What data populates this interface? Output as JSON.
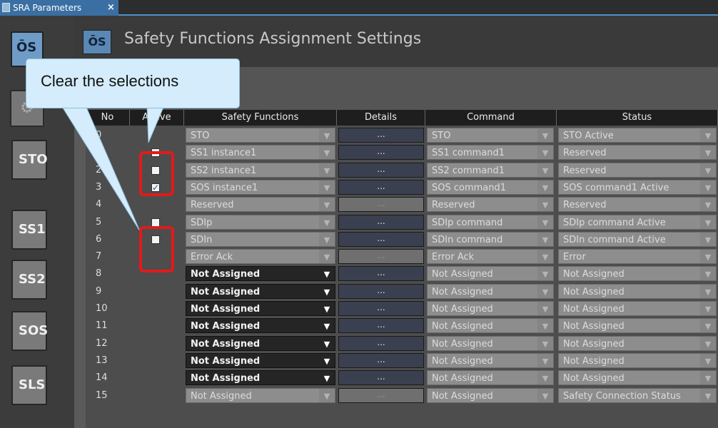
{
  "tab": {
    "title": "SRA Parameters",
    "close": "×"
  },
  "header": {
    "title": "Safety Functions Assignment Settings",
    "icon_text": "ŌS"
  },
  "nav": {
    "top_icon_text": "ŌS",
    "buttons": [
      "STO",
      "SS1",
      "SS2",
      "SOS",
      "SLS"
    ]
  },
  "callout": {
    "text": "Clear the selections"
  },
  "table": {
    "columns": [
      "No",
      "Active",
      "Safety Functions",
      "Details",
      "Command",
      "Status"
    ],
    "details_label": "...",
    "rows": [
      {
        "no": "0",
        "active": "none",
        "function": "STO",
        "command": "STO",
        "status": "STO Active",
        "dim": true
      },
      {
        "no": "1",
        "active": "unchecked",
        "function": "SS1 instance1",
        "command": "SS1 command1",
        "status": "Reserved",
        "dim": true
      },
      {
        "no": "2",
        "active": "unchecked",
        "function": "SS2 instance1",
        "command": "SS2 command1",
        "status": "Reserved",
        "dim": true
      },
      {
        "no": "3",
        "active": "checked",
        "function": "SOS instance1",
        "command": "SOS command1",
        "status": "SOS command1 Active",
        "dim": true
      },
      {
        "no": "4",
        "active": "none",
        "function": "Reserved",
        "command": "Reserved",
        "status": "Reserved",
        "dim": true
      },
      {
        "no": "5",
        "active": "unchecked",
        "function": "SDIp",
        "command": "SDIp command",
        "status": "SDIp command Active",
        "dim": true
      },
      {
        "no": "6",
        "active": "unchecked",
        "function": "SDIn",
        "command": "SDIn command",
        "status": "SDIn command Active",
        "dim": true
      },
      {
        "no": "7",
        "active": "none",
        "function": "Error Ack",
        "command": "Error Ack",
        "status": "Error",
        "dim": true
      },
      {
        "no": "8",
        "active": "none",
        "function": "Not Assigned",
        "command": "Not Assigned",
        "status": "Not Assigned",
        "dim": false
      },
      {
        "no": "9",
        "active": "none",
        "function": "Not Assigned",
        "command": "Not Assigned",
        "status": "Not Assigned",
        "dim": false
      },
      {
        "no": "10",
        "active": "none",
        "function": "Not Assigned",
        "command": "Not Assigned",
        "status": "Not Assigned",
        "dim": false
      },
      {
        "no": "11",
        "active": "none",
        "function": "Not Assigned",
        "command": "Not Assigned",
        "status": "Not Assigned",
        "dim": false
      },
      {
        "no": "12",
        "active": "none",
        "function": "Not Assigned",
        "command": "Not Assigned",
        "status": "Not Assigned",
        "dim": false
      },
      {
        "no": "13",
        "active": "none",
        "function": "Not Assigned",
        "command": "Not Assigned",
        "status": "Not Assigned",
        "dim": false
      },
      {
        "no": "14",
        "active": "none",
        "function": "Not Assigned",
        "command": "Not Assigned",
        "status": "Not Assigned",
        "dim": false
      },
      {
        "no": "15",
        "active": "none",
        "function": "Not Assigned",
        "command": "Not Assigned",
        "status": "Safety Connection Status",
        "dim": true
      }
    ]
  },
  "colors": {
    "highlight": "#e21a1a",
    "callout_bg": "#d4ecfb",
    "tab_accent": "#3a6fa3"
  },
  "icons": {
    "tab": "document-icon",
    "check": "checkmark-icon",
    "dropdown": "triangle-down-icon",
    "tool": "wrench-gear-icon"
  }
}
